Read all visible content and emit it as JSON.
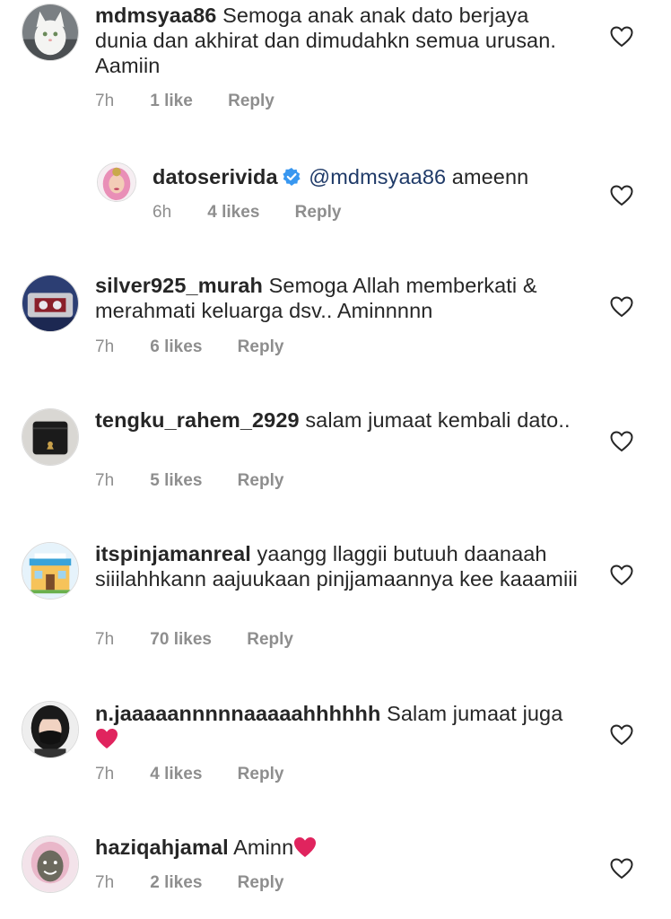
{
  "comments": [
    {
      "username": "mdmsyaa86",
      "text": "Semoga anak anak dato berjaya dunia dan akhirat dan dimudahkn semua urusan. Aamiin",
      "time": "7h",
      "likes": "1 like",
      "reply": "Reply",
      "avatar": "white-cat-avatar"
    },
    {
      "username": "datoserivida",
      "verified": true,
      "mention": "@mdmsyaa86",
      "text": "ameenn",
      "time": "6h",
      "likes": "4 likes",
      "reply": "Reply",
      "avatar": "woman-pink-hijab-avatar"
    },
    {
      "username": "silver925_murah",
      "text": "Semoga Allah memberkati & merahmati keluarga dsv.. Aminnnnn",
      "time": "7h",
      "likes": "6 likes",
      "reply": "Reply",
      "avatar": "jewelry-avatar"
    },
    {
      "username": "tengku_rahem_2929",
      "text": "salam jumaat kembali dato..",
      "time": "7h",
      "likes": "5 likes",
      "reply": "Reply",
      "avatar": "wallet-avatar"
    },
    {
      "username": "itspinjamanreal",
      "text": "yaangg llaggii butuuh daanaah siiilahhkann aajuukaan pinjjamaannya kee kaaamiii",
      "time": "7h",
      "likes": "70 likes",
      "reply": "Reply",
      "avatar": "shop-building-avatar"
    },
    {
      "username": "n.jaaaaannnnnaaaaahhhhhh",
      "text": "Salam jumaat juga",
      "emoji": "red-heart",
      "time": "7h",
      "likes": "4 likes",
      "reply": "Reply",
      "avatar": "woman-mask-avatar"
    },
    {
      "username": "haziqahjamal",
      "text": "Aminn",
      "emoji": "red-heart",
      "time": "7h",
      "likes": "2 likes",
      "reply": "Reply",
      "avatar": "face-mask-avatar"
    }
  ],
  "colors": {
    "text": "#262626",
    "meta": "#8e8e8e",
    "mention": "#1f3a68",
    "verified": "#3897f0",
    "heart_emoji": "#e0245e"
  }
}
